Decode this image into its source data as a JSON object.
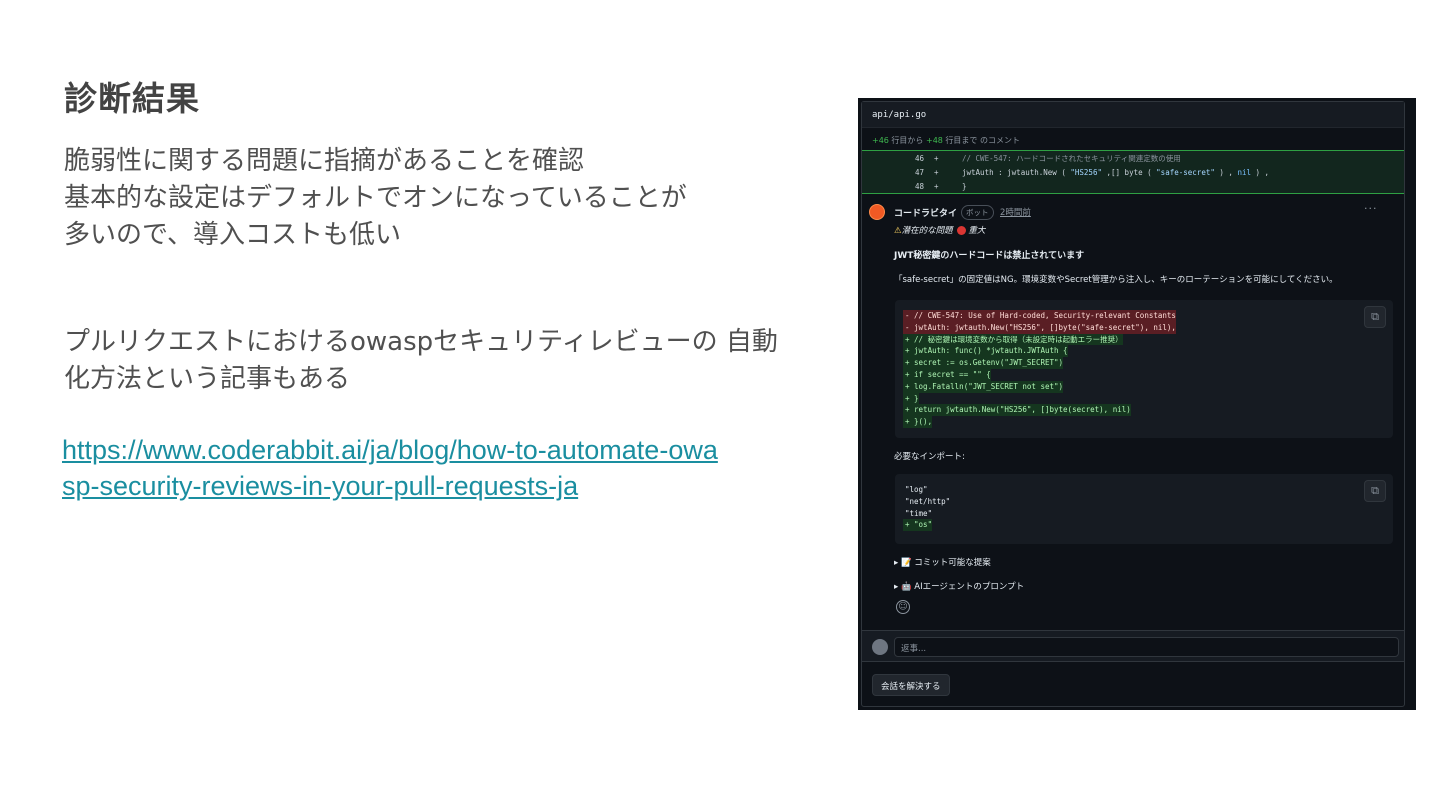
{
  "slide": {
    "title": "診断結果",
    "bullets": [
      "脆弱性に関する問題に指摘があることを確認",
      "基本的な設定はデフォルトでオンになっていることが",
      "多いので、導入コストも低い"
    ],
    "para2": [
      "プルリクエストにおけるowaspセキュリティレビューの 自動",
      "化方法という記事もある"
    ],
    "link": [
      "https://www.coderabbit.ai/ja/blog/how-to-automate-owa",
      "sp-security-reviews-in-your-pull-requests-ja"
    ]
  },
  "screenshot": {
    "file_path": "api/api.go",
    "range_start": "+46",
    "range_mid": " 行目から ",
    "range_end": "+48",
    "range_tail": " 行目まで のコメント",
    "code_lines": [
      {
        "num": "46",
        "sign": "+",
        "text": "        // CWE-547: ハードコードされたセキュリティ関連定数の使用"
      },
      {
        "num": "47",
        "sign": "+",
        "text_a": "        jwtAuth : jwtauth.New ( ",
        "str1": "\"HS256\"",
        "text_b": " ,[] byte ( ",
        "str2": "\"safe-secret\"",
        "text_c": " ) , ",
        "kw": "nil",
        "text_d": " ) ,"
      },
      {
        "num": "48",
        "sign": "+",
        "text": "    }"
      }
    ],
    "comment": {
      "author": "コードラビタイ",
      "badge": "ボット",
      "time": "2時間前",
      "more": "···",
      "issue_label": "潜在的な問題",
      "severity": "重大",
      "heading": "JWT秘密鍵のハードコードは禁止されています",
      "description": "「safe-secret」の固定値はNG。環境変数やSecret管理から注入し、キーのローテーションを可能にしてください。",
      "suggestion": [
        {
          "type": "del",
          "text": "-         // CWE-547: Use of Hard-coded, Security-relevant Constants"
        },
        {
          "type": "del",
          "text": "-         jwtAuth: jwtauth.New(\"HS256\", []byte(\"safe-secret\"), nil),"
        },
        {
          "type": "add",
          "text": "+         // 秘密鍵は環境変数から取得（未設定時は起動エラー推奨）"
        },
        {
          "type": "add",
          "text": "+         jwtAuth: func() *jwtauth.JWTAuth {"
        },
        {
          "type": "add",
          "text": "+             secret := os.Getenv(\"JWT_SECRET\")"
        },
        {
          "type": "add",
          "text": "+             if secret == \"\" {"
        },
        {
          "type": "add",
          "text": "+                 log.Fatalln(\"JWT_SECRET not set\")"
        },
        {
          "type": "add",
          "text": "+             }"
        },
        {
          "type": "add",
          "text": "+             return jwtauth.New(\"HS256\", []byte(secret), nil)"
        },
        {
          "type": "add",
          "text": "+         }(),"
        }
      ],
      "imports_label": "必要なインポート:",
      "imports": [
        {
          "type": "ctx",
          "text": "    \"log\""
        },
        {
          "type": "ctx",
          "text": "    \"net/http\""
        },
        {
          "type": "ctx",
          "text": "    \"time\""
        },
        {
          "type": "add",
          "text": "+  \"os\""
        }
      ],
      "details": [
        "▸ 📝 コミット可能な提案",
        "▸ 🤖 AIエージェントのプロンプト"
      ]
    },
    "reply_placeholder": "返事...",
    "resolve_label": "会話を解決する"
  }
}
